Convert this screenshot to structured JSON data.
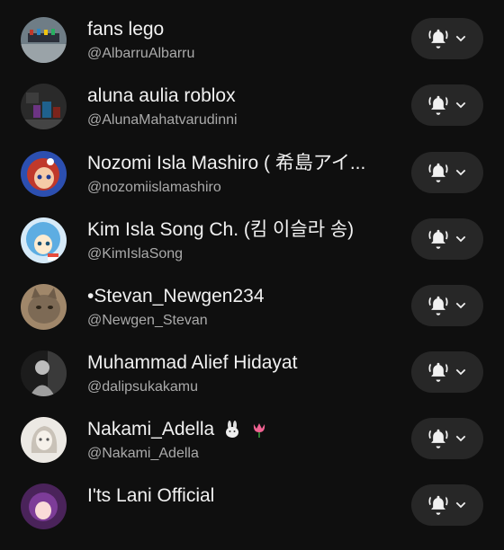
{
  "subscriptions": [
    {
      "name": "fans lego",
      "handle": "@AlbarruAlbarru",
      "avatar_icon": "avatar-lego-scene-icon"
    },
    {
      "name": "aluna aulia roblox",
      "handle": "@AlunaMahatvarudinni",
      "avatar_icon": "avatar-roblox-scene-icon"
    },
    {
      "name": "Nozomi Isla Mashiro ( 希島アイ...",
      "handle": "@nozomiislamashiro",
      "avatar_icon": "avatar-anime-girl-red-hair-icon"
    },
    {
      "name": "Kim Isla Song Ch. (킴 이슬라 송)",
      "handle": "@KimIslaSong",
      "avatar_icon": "avatar-anime-girl-blue-hair-icon"
    },
    {
      "name": "•Stevan_Newgen234",
      "handle": "@Newgen_Stevan",
      "avatar_icon": "avatar-cat-icon"
    },
    {
      "name": "Muhammad Alief Hidayat",
      "handle": "@dalipsukakamu",
      "avatar_icon": "avatar-person-photo-icon"
    },
    {
      "name": "Nakami_Adella",
      "handle": "@Nakami_Adella",
      "avatar_icon": "avatar-sketch-girl-icon",
      "emojis": [
        "rabbit-emoji-icon",
        "tulip-emoji-icon"
      ]
    },
    {
      "name": "I'ts Lani Official",
      "handle": "",
      "avatar_icon": "avatar-anime-purple-icon"
    }
  ],
  "notification_button": {
    "bell_icon": "bell-icon",
    "dropdown_icon": "chevron-down-icon"
  },
  "colors": {
    "background": "#0f0f0f",
    "button_bg": "#272727",
    "text_primary": "#f1f1f1",
    "text_secondary": "#aaaaaa"
  }
}
